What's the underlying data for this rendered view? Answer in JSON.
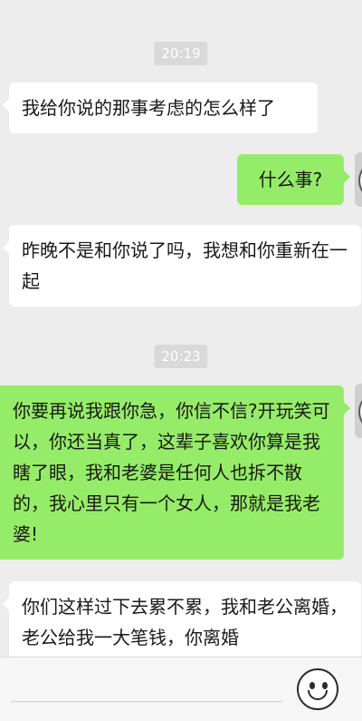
{
  "messages": [
    {
      "type": "time",
      "text": "20:19"
    },
    {
      "type": "incoming",
      "text": "我给你说的那事考虑的怎么样了"
    },
    {
      "type": "outgoing",
      "text": "什么事?"
    },
    {
      "type": "incoming",
      "text": "昨晚不是和你说了吗，我想和你重新在一起"
    },
    {
      "type": "time",
      "text": "20:23"
    },
    {
      "type": "outgoing",
      "text": "你要再说我跟你急，你信不信?开玩笑可以，你还当真了，这辈子喜欢你算是我瞎了眼，我和老婆是任何人也拆不散的，我心里只有一个女人，那就是我老婆!"
    },
    {
      "type": "incoming",
      "text": "你们这样过下去累不累，我和老公离婚，老公给我一大笔钱，你离婚"
    }
  ],
  "input": {
    "placeholder": ""
  },
  "icons": {
    "emoji": "emoji-icon",
    "avatar": "user-avatar"
  },
  "colors": {
    "outgoing_bubble": "#95ec69",
    "incoming_bubble": "#ffffff",
    "background": "#ededed"
  }
}
